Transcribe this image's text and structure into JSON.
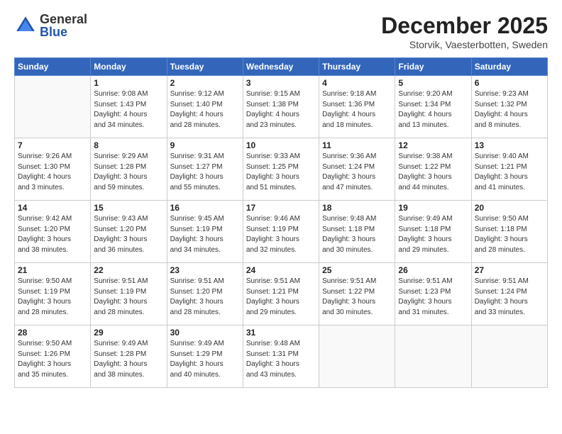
{
  "logo": {
    "general": "General",
    "blue": "Blue"
  },
  "title": "December 2025",
  "subtitle": "Storvik, Vaesterbotten, Sweden",
  "weekdays": [
    "Sunday",
    "Monday",
    "Tuesday",
    "Wednesday",
    "Thursday",
    "Friday",
    "Saturday"
  ],
  "weeks": [
    [
      {
        "day": "",
        "info": ""
      },
      {
        "day": "1",
        "info": "Sunrise: 9:08 AM\nSunset: 1:43 PM\nDaylight: 4 hours\nand 34 minutes."
      },
      {
        "day": "2",
        "info": "Sunrise: 9:12 AM\nSunset: 1:40 PM\nDaylight: 4 hours\nand 28 minutes."
      },
      {
        "day": "3",
        "info": "Sunrise: 9:15 AM\nSunset: 1:38 PM\nDaylight: 4 hours\nand 23 minutes."
      },
      {
        "day": "4",
        "info": "Sunrise: 9:18 AM\nSunset: 1:36 PM\nDaylight: 4 hours\nand 18 minutes."
      },
      {
        "day": "5",
        "info": "Sunrise: 9:20 AM\nSunset: 1:34 PM\nDaylight: 4 hours\nand 13 minutes."
      },
      {
        "day": "6",
        "info": "Sunrise: 9:23 AM\nSunset: 1:32 PM\nDaylight: 4 hours\nand 8 minutes."
      }
    ],
    [
      {
        "day": "7",
        "info": "Sunrise: 9:26 AM\nSunset: 1:30 PM\nDaylight: 4 hours\nand 3 minutes."
      },
      {
        "day": "8",
        "info": "Sunrise: 9:29 AM\nSunset: 1:28 PM\nDaylight: 3 hours\nand 59 minutes."
      },
      {
        "day": "9",
        "info": "Sunrise: 9:31 AM\nSunset: 1:27 PM\nDaylight: 3 hours\nand 55 minutes."
      },
      {
        "day": "10",
        "info": "Sunrise: 9:33 AM\nSunset: 1:25 PM\nDaylight: 3 hours\nand 51 minutes."
      },
      {
        "day": "11",
        "info": "Sunrise: 9:36 AM\nSunset: 1:24 PM\nDaylight: 3 hours\nand 47 minutes."
      },
      {
        "day": "12",
        "info": "Sunrise: 9:38 AM\nSunset: 1:22 PM\nDaylight: 3 hours\nand 44 minutes."
      },
      {
        "day": "13",
        "info": "Sunrise: 9:40 AM\nSunset: 1:21 PM\nDaylight: 3 hours\nand 41 minutes."
      }
    ],
    [
      {
        "day": "14",
        "info": "Sunrise: 9:42 AM\nSunset: 1:20 PM\nDaylight: 3 hours\nand 38 minutes."
      },
      {
        "day": "15",
        "info": "Sunrise: 9:43 AM\nSunset: 1:20 PM\nDaylight: 3 hours\nand 36 minutes."
      },
      {
        "day": "16",
        "info": "Sunrise: 9:45 AM\nSunset: 1:19 PM\nDaylight: 3 hours\nand 34 minutes."
      },
      {
        "day": "17",
        "info": "Sunrise: 9:46 AM\nSunset: 1:19 PM\nDaylight: 3 hours\nand 32 minutes."
      },
      {
        "day": "18",
        "info": "Sunrise: 9:48 AM\nSunset: 1:18 PM\nDaylight: 3 hours\nand 30 minutes."
      },
      {
        "day": "19",
        "info": "Sunrise: 9:49 AM\nSunset: 1:18 PM\nDaylight: 3 hours\nand 29 minutes."
      },
      {
        "day": "20",
        "info": "Sunrise: 9:50 AM\nSunset: 1:18 PM\nDaylight: 3 hours\nand 28 minutes."
      }
    ],
    [
      {
        "day": "21",
        "info": "Sunrise: 9:50 AM\nSunset: 1:19 PM\nDaylight: 3 hours\nand 28 minutes."
      },
      {
        "day": "22",
        "info": "Sunrise: 9:51 AM\nSunset: 1:19 PM\nDaylight: 3 hours\nand 28 minutes."
      },
      {
        "day": "23",
        "info": "Sunrise: 9:51 AM\nSunset: 1:20 PM\nDaylight: 3 hours\nand 28 minutes."
      },
      {
        "day": "24",
        "info": "Sunrise: 9:51 AM\nSunset: 1:21 PM\nDaylight: 3 hours\nand 29 minutes."
      },
      {
        "day": "25",
        "info": "Sunrise: 9:51 AM\nSunset: 1:22 PM\nDaylight: 3 hours\nand 30 minutes."
      },
      {
        "day": "26",
        "info": "Sunrise: 9:51 AM\nSunset: 1:23 PM\nDaylight: 3 hours\nand 31 minutes."
      },
      {
        "day": "27",
        "info": "Sunrise: 9:51 AM\nSunset: 1:24 PM\nDaylight: 3 hours\nand 33 minutes."
      }
    ],
    [
      {
        "day": "28",
        "info": "Sunrise: 9:50 AM\nSunset: 1:26 PM\nDaylight: 3 hours\nand 35 minutes."
      },
      {
        "day": "29",
        "info": "Sunrise: 9:49 AM\nSunset: 1:28 PM\nDaylight: 3 hours\nand 38 minutes."
      },
      {
        "day": "30",
        "info": "Sunrise: 9:49 AM\nSunset: 1:29 PM\nDaylight: 3 hours\nand 40 minutes."
      },
      {
        "day": "31",
        "info": "Sunrise: 9:48 AM\nSunset: 1:31 PM\nDaylight: 3 hours\nand 43 minutes."
      },
      {
        "day": "",
        "info": ""
      },
      {
        "day": "",
        "info": ""
      },
      {
        "day": "",
        "info": ""
      }
    ]
  ]
}
